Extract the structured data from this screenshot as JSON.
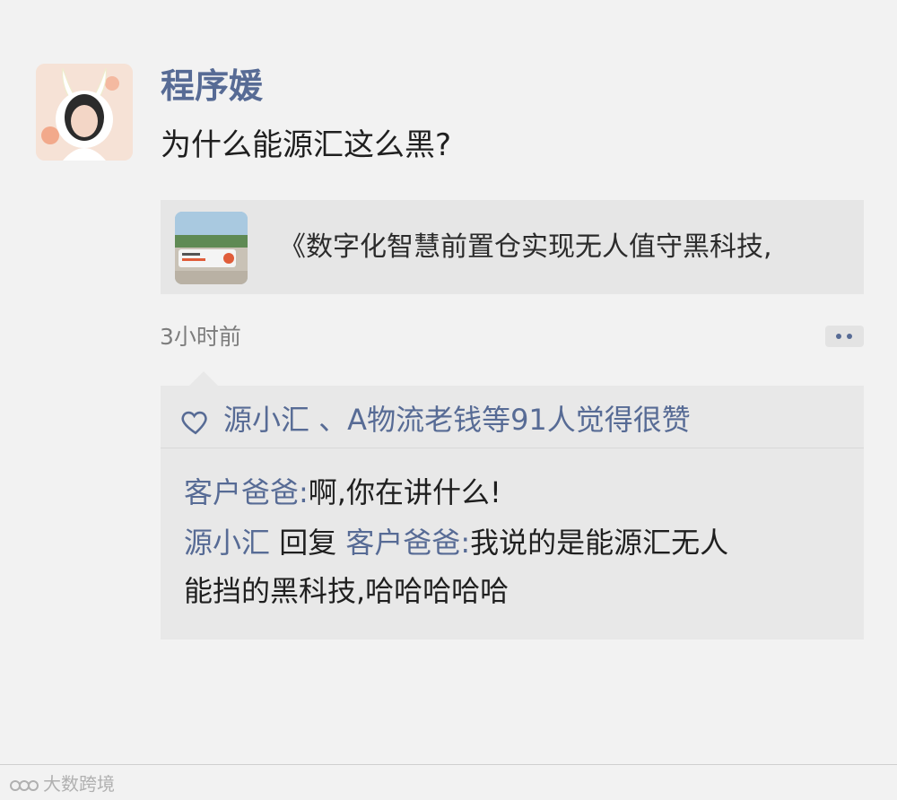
{
  "post": {
    "author": "程序媛",
    "text": "为什么能源汇这么黑?",
    "time": "3小时前"
  },
  "link_card": {
    "title": "《数字化智慧前置仓实现无人值守黑科技,"
  },
  "likes": {
    "text": "源小汇 、A物流老钱等91人觉得很赞"
  },
  "comments": [
    {
      "name": "客户爸爸",
      "separator": ":",
      "text": "啊,你在讲什么!"
    },
    {
      "name": "源小汇",
      "reply_word": "回复",
      "reply_to": "客户爸爸",
      "separator": ":",
      "text_line1": "我说的是能源汇无人",
      "text_line2": "能挡的黑科技,哈哈哈哈哈"
    }
  ],
  "watermark": {
    "text": "大数跨境"
  },
  "colors": {
    "link_blue": "#576b95",
    "background": "#f2f2f2",
    "card": "#e6e6e6"
  },
  "icons": {
    "like": "heart-outline-icon",
    "more": "more-dots-icon"
  }
}
